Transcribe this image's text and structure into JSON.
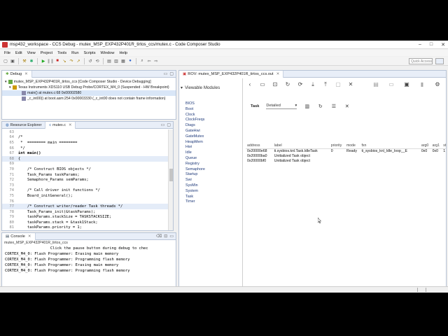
{
  "window": {
    "title": "msp432_workspace - CCS Debug - mutex_MSP_EXP432P401R_tirtos_ccs/mutex.c - Code Composer Studio",
    "controls": [
      "–",
      "□",
      "✕"
    ]
  },
  "menu": [
    "File",
    "Edit",
    "View",
    "Project",
    "Tools",
    "Run",
    "Scripts",
    "Window",
    "Help"
  ],
  "toolbar": {
    "quick_access_placeholder": "Quick Access"
  },
  "debug": {
    "tab_label": "Debug",
    "rows": [
      "mutex_MSP_EXP432P401R_tirtos_ccs [Code Composer Studio - Device Debugging]",
      "Texas Instruments XDS110 USB Debug Probe/CORTEX_M4_0 (Suspended - HW Breakpoint)",
      "main() at mutex.c:68 0x00002580",
      "_c_int00() at boot.asm:254 0x00003330  (_c_int00 does not contain frame information)"
    ]
  },
  "editor": {
    "tabs": [
      {
        "label": "Resource Explorer"
      },
      {
        "label": "mutex.c"
      }
    ],
    "lines": [
      {
        "n": "63",
        "text": ""
      },
      {
        "n": "64",
        "text": "/*"
      },
      {
        "n": "65",
        "text": " *  ======== main ========"
      },
      {
        "n": "66",
        "text": " */"
      },
      {
        "n": "67",
        "text": "int main()"
      },
      {
        "n": "68",
        "text": "{"
      },
      {
        "n": "69",
        "text": ""
      },
      {
        "n": "70",
        "text": "    /* Construct BIOS objects */"
      },
      {
        "n": "71",
        "text": "    Task_Params taskParams;"
      },
      {
        "n": "72",
        "text": "    Semaphore_Params semParams;"
      },
      {
        "n": "73",
        "text": ""
      },
      {
        "n": "74",
        "text": "    /* Call driver init functions */"
      },
      {
        "n": "75",
        "text": "    Board_initGeneral();"
      },
      {
        "n": "76",
        "text": ""
      },
      {
        "n": "77",
        "text": "    /* Construct writer/reader Task threads */"
      },
      {
        "n": "78",
        "text": "    Task_Params_init(&taskParams);"
      },
      {
        "n": "79",
        "text": "    taskParams.stackSize = TASKSTACKSIZE;"
      },
      {
        "n": "80",
        "text": "    taskParams.stack = &task1Stack;"
      },
      {
        "n": "81",
        "text": "    taskParams.priority = 1;"
      }
    ]
  },
  "console": {
    "tab_label": "Console",
    "subtitle": "mutex_MSP_EXP432P401R_tirtos_ccs",
    "lines": [
      "                    Click the pause button during debug to chec",
      "CORTEX_M4_0: Flash Programmer: Erasing main memory",
      "CORTEX_M4_0: Flash Programmer: Programming flash memory",
      "CORTEX_M4_0: Flash Programmer: Erasing main memory",
      "CORTEX_M4_0: Flash Programmer: Programming flash memory"
    ]
  },
  "rov": {
    "tab_label": "ROV: mutex_MSP_EXP432P401R_tirtos_ccs.out",
    "modules_label": "Viewable Modules",
    "modules": [
      "BIOS",
      "Boot",
      "Clock",
      "ClockFreqs",
      "Diags",
      "GateHwi",
      "GateMutex",
      "HeapMem",
      "Hwi",
      "Idle",
      "Queue",
      "Registry",
      "Semaphore",
      "Startup",
      "Swi",
      "SysMin",
      "System",
      "Task",
      "Timer"
    ],
    "view_label": "Task",
    "view_mode": "Detailed",
    "columns": [
      "address",
      "label",
      "priority",
      "mode",
      "fxn",
      "arg0",
      "arg1",
      "st"
    ],
    "rows": [
      [
        "0x20000e68",
        "ti.sysbios.knl.Task.IdleTask",
        "0",
        "Ready",
        "ti_sysbios_knl_Idle_loop__E",
        "0x0",
        "0x0",
        "1"
      ],
      [
        "0x20000ba0",
        "Unitialized Task object",
        "",
        "",
        "",
        "",
        "",
        ""
      ],
      [
        "0x20000bf0",
        "Unitialized Task object",
        "",
        "",
        "",
        "",
        "",
        ""
      ]
    ]
  }
}
